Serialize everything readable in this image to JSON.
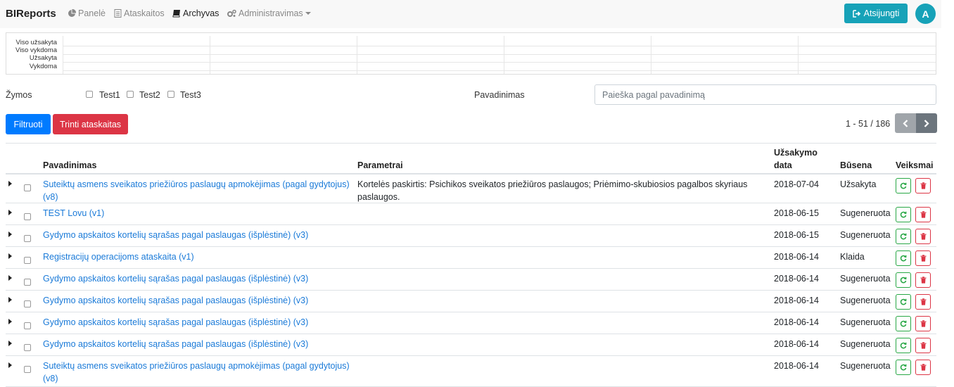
{
  "navbar": {
    "brand": "BIReports",
    "items": [
      {
        "label": "Panelė",
        "icon": "pie-chart-icon"
      },
      {
        "label": "Ataskaitos",
        "icon": "document-icon"
      },
      {
        "label": "Archyvas",
        "icon": "book-icon"
      },
      {
        "label": "Administravimas",
        "icon": "gears-icon"
      }
    ],
    "logout_label": "Atsijungti",
    "avatar_letter": "A"
  },
  "summary": {
    "labels": [
      "Viso užsakyta",
      "Viso vykdoma",
      "Užsakyta",
      "Vykdoma"
    ]
  },
  "filters": {
    "tags_label": "Žymos",
    "tags": [
      "Test1",
      "Test2",
      "Test3"
    ],
    "name_label": "Pavadinimas",
    "search_placeholder": "Paieška pagal pavadinimą"
  },
  "actions": {
    "filter_label": "Filtruoti",
    "delete_label": "Trinti ataskaitas"
  },
  "pagination": {
    "text": "1 - 51 / 186"
  },
  "table": {
    "headers": {
      "name": "Pavadinimas",
      "params": "Parametrai",
      "date_line1": "Užsakymo",
      "date_line2": "data",
      "status": "Būsena",
      "actions": "Veiksmai"
    },
    "rows": [
      {
        "name": "Suteiktų asmens sveikatos priežiūros paslaugų apmokėjimas (pagal gydytojus) (v8)",
        "params": "Kortelės paskirtis: Psichikos sveikatos priežiūros paslaugos; Priėmimo-skubiosios pagalbos skyriaus paslaugos.",
        "date": "2018-07-04",
        "status": "Užsakyta"
      },
      {
        "name": "TEST Lovu (v1)",
        "params": "",
        "date": "2018-06-15",
        "status": "Sugeneruota"
      },
      {
        "name": "Gydymo apskaitos kortelių sąrašas pagal paslaugas (išplėstinė) (v3)",
        "params": "",
        "date": "2018-06-15",
        "status": "Sugeneruota"
      },
      {
        "name": "Registracijų operacijoms ataskaita (v1)",
        "params": "",
        "date": "2018-06-14",
        "status": "Klaida"
      },
      {
        "name": "Gydymo apskaitos kortelių sąrašas pagal paslaugas (išplėstinė) (v3)",
        "params": "",
        "date": "2018-06-14",
        "status": "Sugeneruota"
      },
      {
        "name": "Gydymo apskaitos kortelių sąrašas pagal paslaugas (išplėstinė) (v3)",
        "params": "",
        "date": "2018-06-14",
        "status": "Sugeneruota"
      },
      {
        "name": "Gydymo apskaitos kortelių sąrašas pagal paslaugas (išplėstinė) (v3)",
        "params": "",
        "date": "2018-06-14",
        "status": "Sugeneruota"
      },
      {
        "name": "Gydymo apskaitos kortelių sąrašas pagal paslaugas (išplėstinė) (v3)",
        "params": "",
        "date": "2018-06-14",
        "status": "Sugeneruota"
      },
      {
        "name": "Suteiktų asmens sveikatos priežiūros paslaugų apmokėjimas (pagal gydytojus) (v8)",
        "params": "",
        "date": "2018-06-14",
        "status": "Sugeneruota"
      }
    ]
  },
  "colors": {
    "primary": "#007bff",
    "danger": "#dc3545",
    "info": "#17a2b8",
    "success": "#28a745",
    "link": "#1a7ad8"
  }
}
